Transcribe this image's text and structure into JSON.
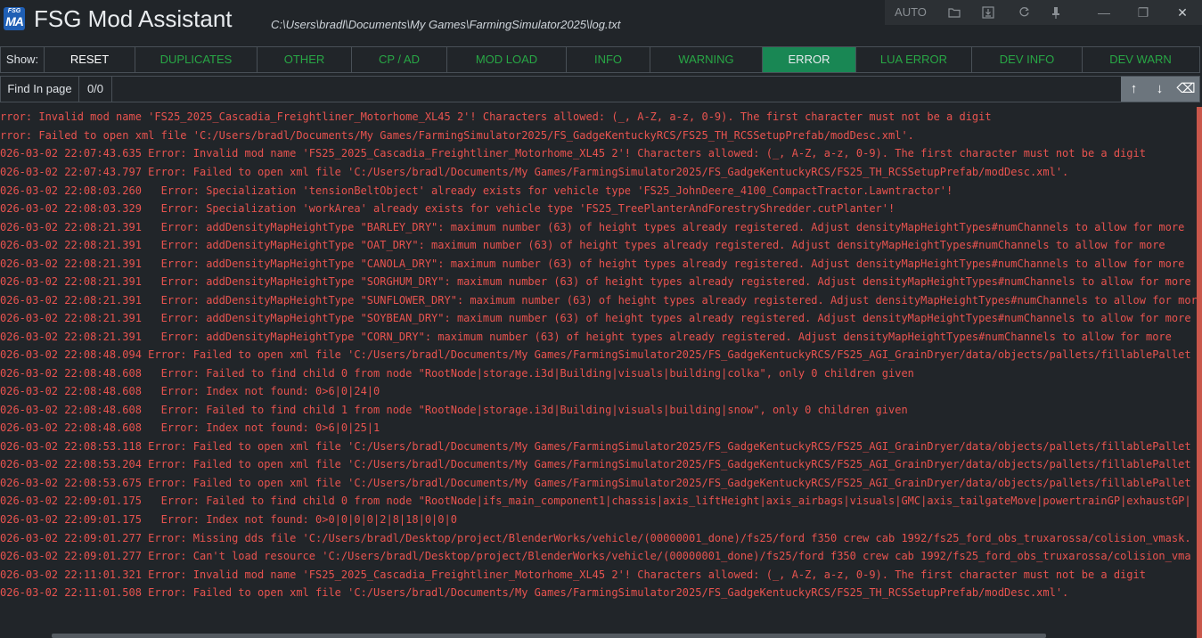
{
  "app": {
    "logo_top": "FSG",
    "logo_main": "MA",
    "title": "FSG Mod Assistant",
    "log_path": "C:\\Users\\bradl\\Documents\\My Games\\FarmingSimulator2025\\log.txt"
  },
  "window_controls": {
    "auto_label": "AUTO",
    "folder_icon": "folder-icon",
    "save_icon": "download-icon",
    "refresh_icon": "refresh-icon",
    "pin_icon": "pin-icon",
    "minimize": "—",
    "restore": "❐",
    "close": "✕"
  },
  "filters": {
    "show_label": "Show:",
    "buttons": [
      "RESET",
      "DUPLICATES",
      "OTHER",
      "CP / AD",
      "MOD LOAD",
      "INFO",
      "WARNING",
      "ERROR",
      "LUA ERROR",
      "DEV INFO",
      "DEV WARN"
    ],
    "active": "ERROR",
    "colors": {
      "active_bg": "#198754",
      "inactive_text": "#28a745"
    }
  },
  "find": {
    "label": "Find In page",
    "count": "0/0",
    "placeholder": "",
    "up": "↑",
    "down": "↓",
    "clear": "⌫"
  },
  "log_lines": [
    "rror: Invalid mod name 'FS25_2025_Cascadia_Freightliner_Motorhome_XL45 2'! Characters allowed: (_, A-Z, a-z, 0-9). The first character must not be a digit",
    "rror: Failed to open xml file 'C:/Users/bradl/Documents/My Games/FarmingSimulator2025/FS_GadgeKentuckyRCS/FS25_TH_RCSSetupPrefab/modDesc.xml'.",
    "026-03-02 22:07:43.635 Error: Invalid mod name 'FS25_2025_Cascadia_Freightliner_Motorhome_XL45 2'! Characters allowed: (_, A-Z, a-z, 0-9). The first character must not be a digit",
    "026-03-02 22:07:43.797 Error: Failed to open xml file 'C:/Users/bradl/Documents/My Games/FarmingSimulator2025/FS_GadgeKentuckyRCS/FS25_TH_RCSSetupPrefab/modDesc.xml'.",
    "026-03-02 22:08:03.260   Error: Specialization 'tensionBeltObject' already exists for vehicle type 'FS25_JohnDeere_4100_CompactTractor.Lawntractor'!",
    "026-03-02 22:08:03.329   Error: Specialization 'workArea' already exists for vehicle type 'FS25_TreePlanterAndForestryShredder.cutPlanter'!",
    "026-03-02 22:08:21.391   Error: addDensityMapHeightType \"BARLEY_DRY\": maximum number (63) of height types already registered. Adjust densityMapHeightTypes#numChannels to allow for more",
    "026-03-02 22:08:21.391   Error: addDensityMapHeightType \"OAT_DRY\": maximum number (63) of height types already registered. Adjust densityMapHeightTypes#numChannels to allow for more",
    "026-03-02 22:08:21.391   Error: addDensityMapHeightType \"CANOLA_DRY\": maximum number (63) of height types already registered. Adjust densityMapHeightTypes#numChannels to allow for more",
    "026-03-02 22:08:21.391   Error: addDensityMapHeightType \"SORGHUM_DRY\": maximum number (63) of height types already registered. Adjust densityMapHeightTypes#numChannels to allow for more",
    "026-03-02 22:08:21.391   Error: addDensityMapHeightType \"SUNFLOWER_DRY\": maximum number (63) of height types already registered. Adjust densityMapHeightTypes#numChannels to allow for more",
    "026-03-02 22:08:21.391   Error: addDensityMapHeightType \"SOYBEAN_DRY\": maximum number (63) of height types already registered. Adjust densityMapHeightTypes#numChannels to allow for more",
    "026-03-02 22:08:21.391   Error: addDensityMapHeightType \"CORN_DRY\": maximum number (63) of height types already registered. Adjust densityMapHeightTypes#numChannels to allow for more",
    "026-03-02 22:08:48.094 Error: Failed to open xml file 'C:/Users/bradl/Documents/My Games/FarmingSimulator2025/FS_GadgeKentuckyRCS/FS25_AGI_GrainDryer/data/objects/pallets/fillablePallet",
    "026-03-02 22:08:48.608   Error: Failed to find child 0 from node \"RootNode|storage.i3d|Building|visuals|building|colka\", only 0 children given",
    "026-03-02 22:08:48.608   Error: Index not found: 0>6|0|24|0",
    "026-03-02 22:08:48.608   Error: Failed to find child 1 from node \"RootNode|storage.i3d|Building|visuals|building|snow\", only 0 children given",
    "026-03-02 22:08:48.608   Error: Index not found: 0>6|0|25|1",
    "026-03-02 22:08:53.118 Error: Failed to open xml file 'C:/Users/bradl/Documents/My Games/FarmingSimulator2025/FS_GadgeKentuckyRCS/FS25_AGI_GrainDryer/data/objects/pallets/fillablePallet",
    "026-03-02 22:08:53.204 Error: Failed to open xml file 'C:/Users/bradl/Documents/My Games/FarmingSimulator2025/FS_GadgeKentuckyRCS/FS25_AGI_GrainDryer/data/objects/pallets/fillablePallet",
    "026-03-02 22:08:53.675 Error: Failed to open xml file 'C:/Users/bradl/Documents/My Games/FarmingSimulator2025/FS_GadgeKentuckyRCS/FS25_AGI_GrainDryer/data/objects/pallets/fillablePallet",
    "026-03-02 22:09:01.175   Error: Failed to find child 0 from node \"RootNode|ifs_main_component1|chassis|axis_liftHeight|axis_airbags|visuals|GMC|axis_tailgateMove|powertrainGP|exhaustGP|",
    "026-03-02 22:09:01.175   Error: Index not found: 0>0|0|0|0|2|8|18|0|0|0",
    "026-03-02 22:09:01.277 Error: Missing dds file 'C:/Users/bradl/Desktop/project/BlenderWorks/vehicle/(00000001_done)/fs25/ford f350 crew cab 1992/fs25_ford_obs_truxarossa/colision_vmask.",
    "026-03-02 22:09:01.277 Error: Can't load resource 'C:/Users/bradl/Desktop/project/BlenderWorks/vehicle/(00000001_done)/fs25/ford f350 crew cab 1992/fs25_ford_obs_truxarossa/colision_vma",
    "026-03-02 22:11:01.321 Error: Invalid mod name 'FS25_2025_Cascadia_Freightliner_Motorhome_XL45 2'! Characters allowed: (_, A-Z, a-z, 0-9). The first character must not be a digit",
    "026-03-02 22:11:01.508 Error: Failed to open xml file 'C:/Users/bradl/Documents/My Games/FarmingSimulator2025/FS_GadgeKentuckyRCS/FS25_TH_RCSSetupPrefab/modDesc.xml'."
  ]
}
